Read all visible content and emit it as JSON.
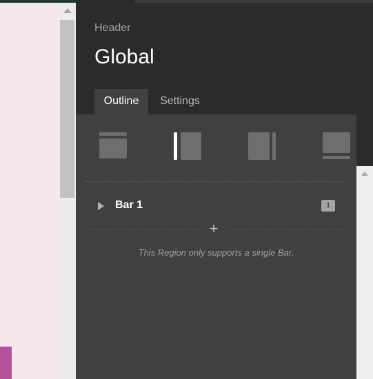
{
  "panel": {
    "subtitle": "Header",
    "title": "Global",
    "tabs": [
      {
        "label": "Outline",
        "active": true
      },
      {
        "label": "Settings",
        "active": false
      }
    ]
  },
  "layouts": [
    {
      "name": "top-layout",
      "icon": "layout-top-icon"
    },
    {
      "name": "left-layout",
      "icon": "layout-left-icon",
      "selected": true
    },
    {
      "name": "right-layout",
      "icon": "layout-right-icon"
    },
    {
      "name": "bottom-layout",
      "icon": "layout-bottom-icon"
    }
  ],
  "bars": [
    {
      "label": "Bar 1",
      "badge": "1"
    }
  ],
  "add_label": "+",
  "note": "This Region only supports a single Bar.",
  "colors": {
    "panel_bg": "#2b2b2b",
    "content_bg": "#404040",
    "preview_bg": "#f7e8ec",
    "preview_accent": "#b5509a"
  }
}
